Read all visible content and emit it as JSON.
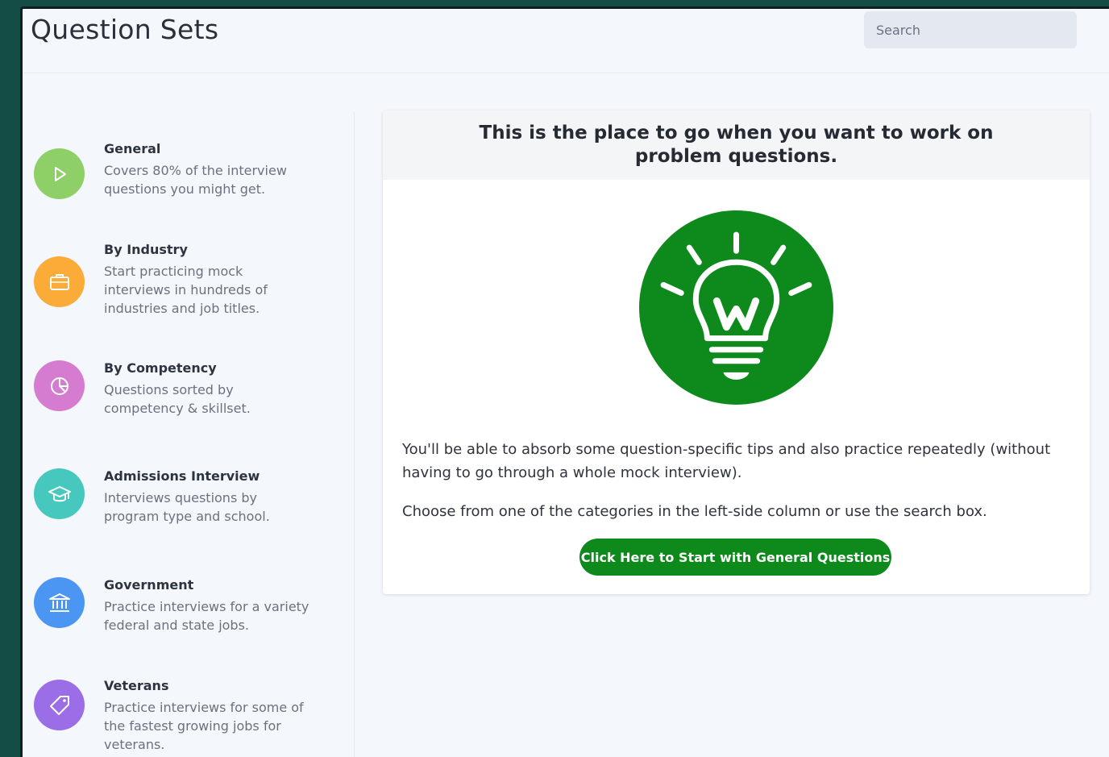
{
  "page_title": "Question Sets",
  "search": {
    "placeholder": "Search"
  },
  "categories": [
    {
      "title": "General",
      "desc": "Covers 80% of the interview questions you might get.",
      "color": "#8fcf68",
      "icon": "play-icon"
    },
    {
      "title": "By Industry",
      "desc": "Start practicing mock interviews in hundreds of industries and job titles.",
      "color": "#fbab37",
      "icon": "briefcase-icon"
    },
    {
      "title": "By Competency",
      "desc": "Questions sorted by competency & skillset.",
      "color": "#d57cd0",
      "icon": "pie-chart-icon"
    },
    {
      "title": "Admissions Interview",
      "desc": "Interviews questions by program type and school.",
      "color": "#47c8bf",
      "icon": "graduation-cap-icon"
    },
    {
      "title": "Government",
      "desc": "Practice interviews for a variety federal and state jobs.",
      "color": "#4b96f3",
      "icon": "bank-icon"
    },
    {
      "title": "Veterans",
      "desc": "Practice interviews for some of the fastest growing jobs for veterans.",
      "color": "#9b6ee8",
      "icon": "tag-icon"
    }
  ],
  "card": {
    "heading": "This is the place to go when you want to work on problem questions.",
    "paragraph1": "You'll be able to absorb some question-specific tips and also practice repeatedly (without having to go through a whole mock interview).",
    "paragraph2": "Choose from one of the categories in the left-side column or use the search box.",
    "button_label": "Click Here to Start with General Questions",
    "illustration_icon": "lightbulb-icon",
    "accent_color": "#0e8a1d"
  }
}
